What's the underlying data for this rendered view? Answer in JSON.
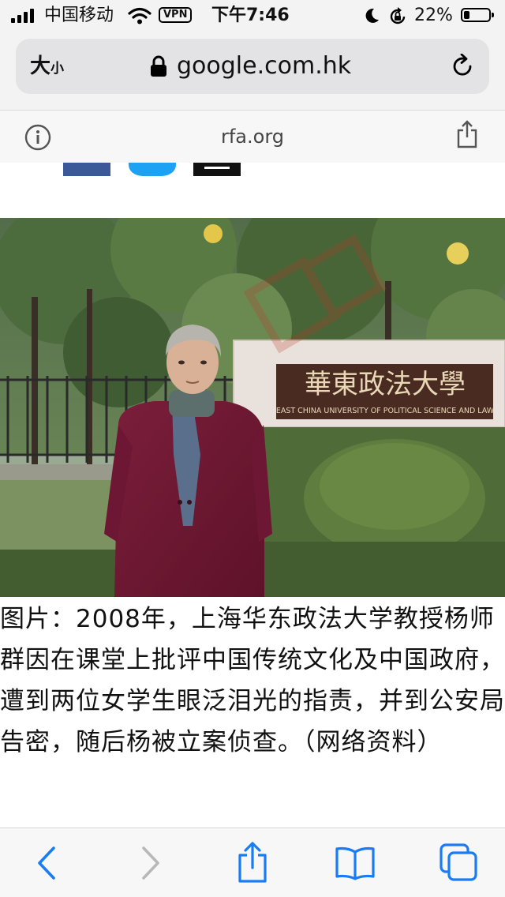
{
  "status_bar": {
    "carrier": "中国移动",
    "vpn_label": "VPN",
    "time": "下午7:46",
    "battery_percent": "22%",
    "battery_level": 0.22
  },
  "address_bar": {
    "text_size_big": "大",
    "text_size_small": "小",
    "url": "google.com.hk"
  },
  "site_bar": {
    "site": "rfa.org"
  },
  "article": {
    "photo_sign_chinese": "華東政法大學",
    "photo_sign_english": "EAST CHINA UNIVERSITY OF POLITICAL SCIENCE AND LAW",
    "caption": "图片：2008年，上海华东政法大学教授杨师群因在课堂上批评中国传统文化及中国政府，遭到两位女学生眼泛泪光的指责，并到公安局告密，随后杨被立案侦查。（网络资料）"
  },
  "colors": {
    "accent": "#1a7cf5",
    "facebook": "#3b5998",
    "twitter": "#1da1f2"
  },
  "icons": {
    "info": "info-icon",
    "share": "share-icon",
    "reload": "reload-icon",
    "back": "back-icon",
    "forward": "forward-icon",
    "bookmarks": "bookmarks-icon",
    "tabs": "tabs-icon"
  }
}
